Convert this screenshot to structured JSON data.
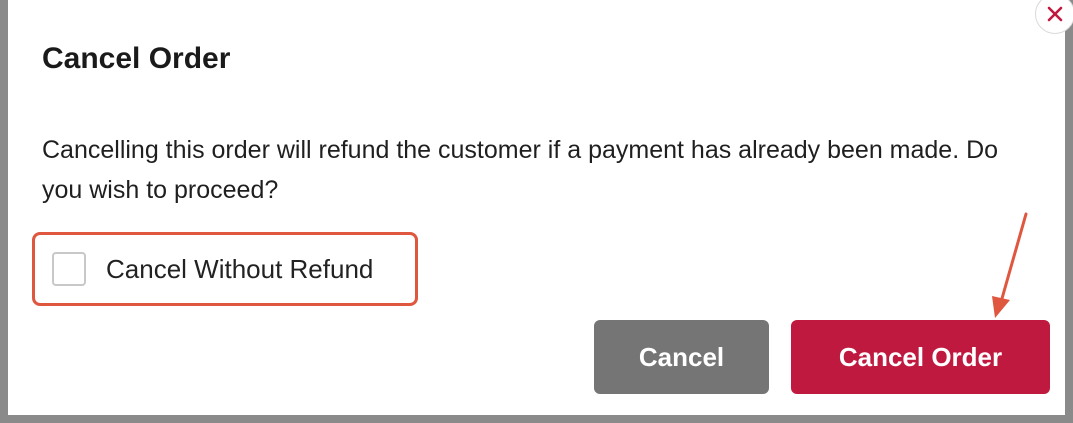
{
  "dialog": {
    "title": "Cancel Order",
    "message": "Cancelling this order will refund the customer if a payment has already been made. Do you wish to proceed?",
    "checkbox": {
      "label": "Cancel Without Refund",
      "checked": false
    },
    "buttons": {
      "cancel_label": "Cancel",
      "confirm_label": "Cancel Order"
    },
    "close_icon": "close-icon"
  },
  "colors": {
    "overlay": "#8a8a8a",
    "accent": "#c0193f",
    "secondary_button": "#757575",
    "annotation": "#e0573f"
  }
}
